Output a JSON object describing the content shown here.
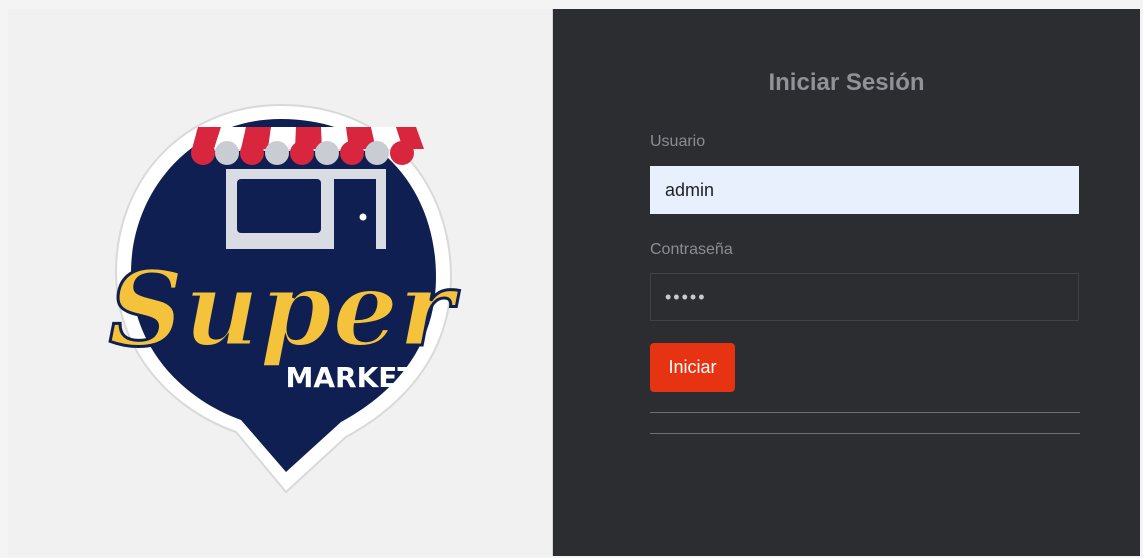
{
  "brand": {
    "logo_word": "Super",
    "logo_subword": "MARKET",
    "colors": {
      "navy": "#0f1f52",
      "gold": "#f5c33b",
      "red": "#d7263d",
      "white": "#ffffff"
    }
  },
  "login": {
    "title": "Iniciar Sesión",
    "username_label": "Usuario",
    "username_value": "admin",
    "password_label": "Contraseña",
    "password_value": "•••••",
    "submit_label": "Iniciar"
  },
  "theme": {
    "panel_bg": "#2b2d31",
    "accent": "#e63312",
    "autofill_bg": "#e8f0fe"
  }
}
